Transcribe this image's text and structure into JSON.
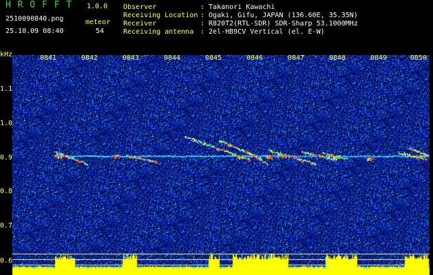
{
  "header": {
    "app_name": "H R O F F T",
    "version": "1.0.0",
    "filename": "2510090840.png",
    "datetime": "25.10.09 08:40",
    "count_label": "meteor",
    "count_value": "54",
    "info": [
      {
        "label": "Observer",
        "value": ": Takanori Kawachi"
      },
      {
        "label": "Receiving Location",
        "value": ": Ogaki, Gifu, JAPAN (136.60E, 35.35N)"
      },
      {
        "label": "Receiver",
        "value": ": R820T2(RTL-SDR) SDR-Sharp 53.1000MHz"
      },
      {
        "label": "Receiving antenna",
        "value": ": 2el-HB9CV Vertical (el. E-W)"
      }
    ]
  },
  "colors": {
    "app_name": "#3fd63f",
    "labels": "#ffff66",
    "text": "#ffffff",
    "background": "#000000",
    "noise": "#1a3bff",
    "trace": "#ff3030",
    "level_bar": "#ffff00"
  },
  "axis": {
    "unit": "kHz",
    "y_ticks": [
      "1.1",
      "1.0",
      "0.9",
      "0.8",
      "0.7",
      "0.6"
    ],
    "x_ticks": [
      "0841",
      "0842",
      "0843",
      "0844",
      "0845",
      "0846",
      "0847",
      "0848",
      "0849",
      "0850"
    ]
  }
}
